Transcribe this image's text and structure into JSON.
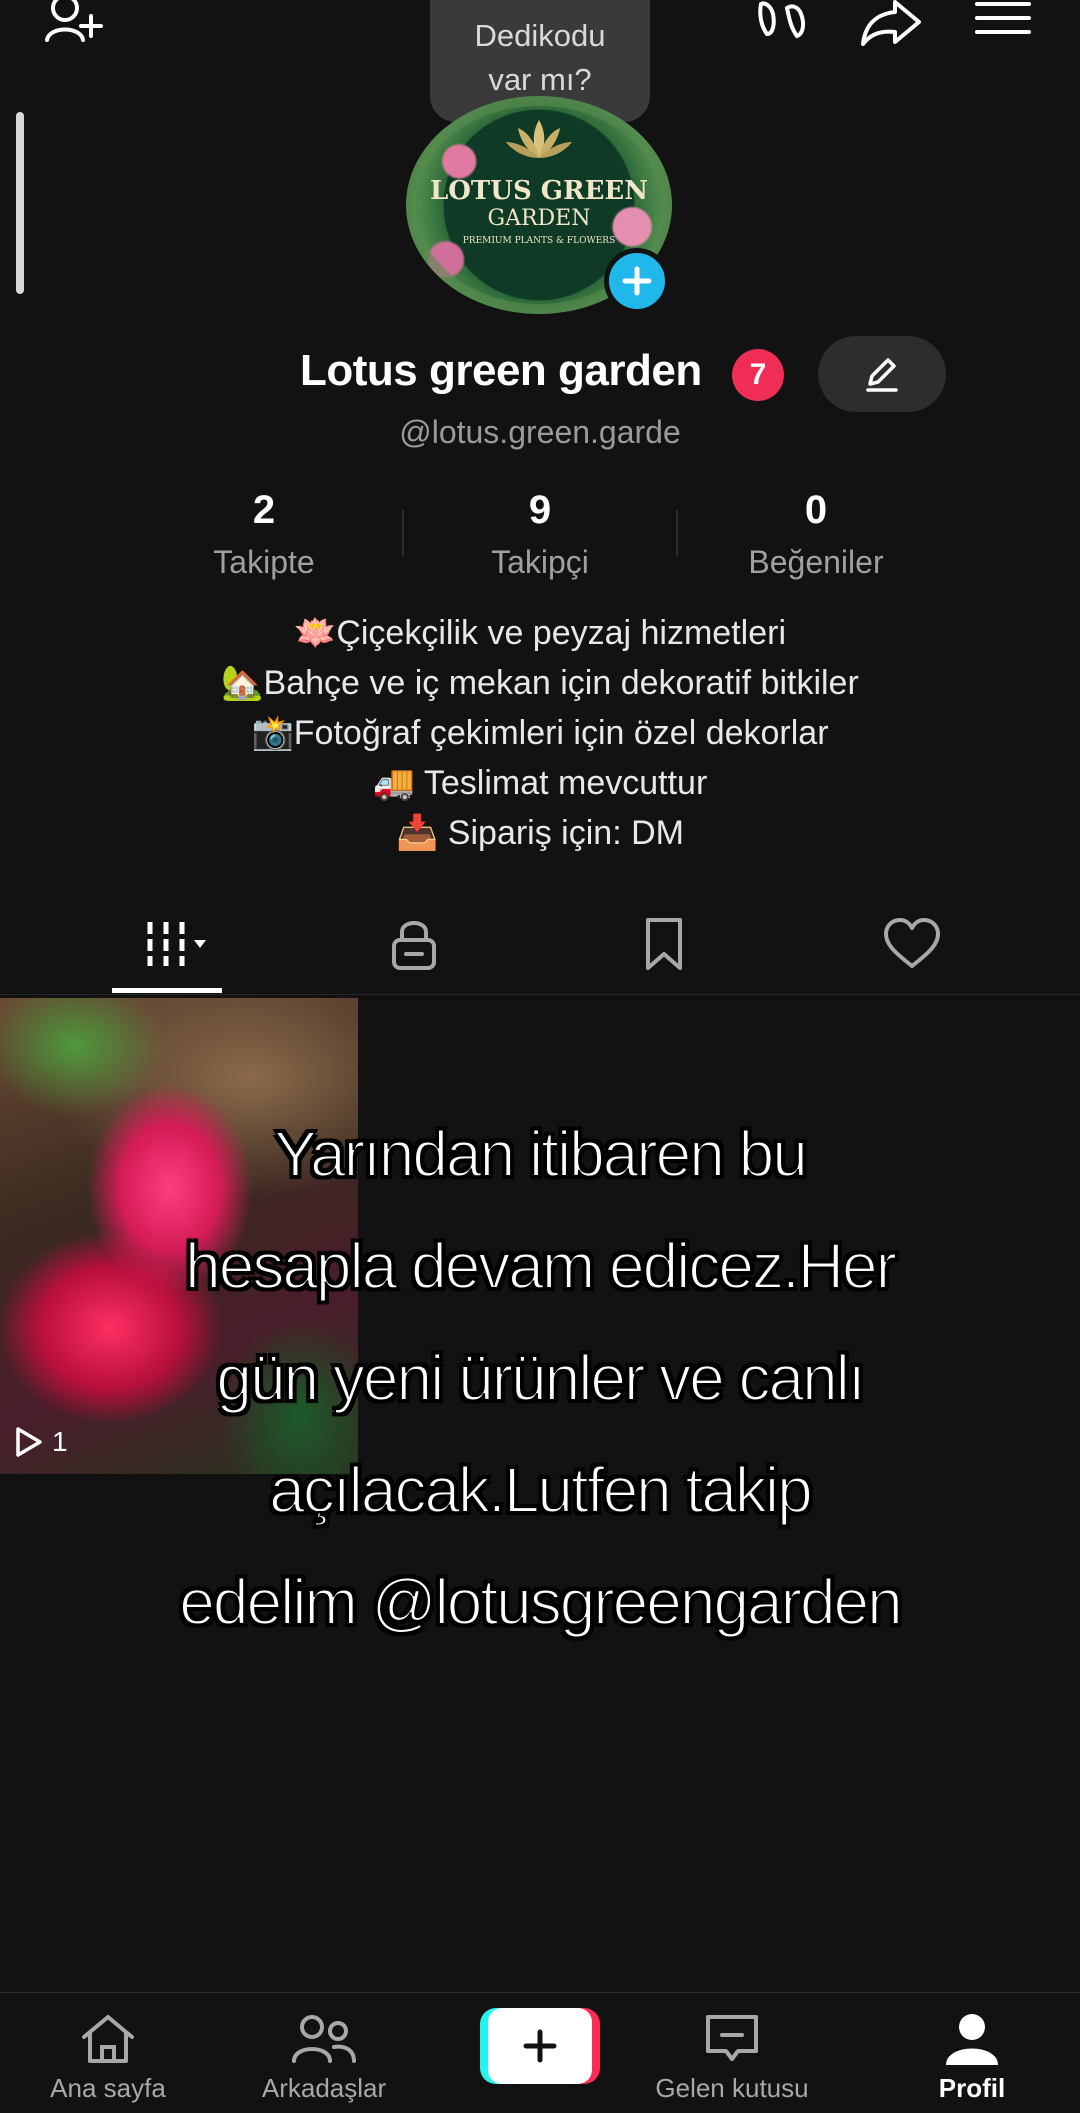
{
  "top_bar": {
    "icons": [
      "add-friend-icon",
      "footprints-icon",
      "share-icon",
      "menu-icon"
    ],
    "tooltip": "Dedikodu\nvar mı?"
  },
  "profile": {
    "avatar": {
      "logo_line1": "LOTUS GREEN",
      "logo_line2": "GARDEN",
      "logo_tagline": "PREMIUM PLANTS & FLOWERS"
    },
    "name": "Lotus green garden",
    "notification_count": "7",
    "handle": "@lotus.green.garde"
  },
  "stats": [
    {
      "value": "2",
      "label": "Takipte"
    },
    {
      "value": "9",
      "label": "Takipçi"
    },
    {
      "value": "0",
      "label": "Beğeniler"
    }
  ],
  "bio": [
    "🪷Çiçekçilik ve peyzaj hizmetleri",
    "🏡Bahçe ve iç mekan için dekoratif bitkiler",
    "📸Fotoğraf çekimleri için özel dekorlar",
    "🚚 Teslimat mevcuttur",
    "📥 Sipariş için: DM"
  ],
  "tabs": [
    "grid-icon",
    "lock-icon",
    "bookmark-icon",
    "heart-icon"
  ],
  "videos": [
    {
      "views": "1"
    }
  ],
  "overlay_text": [
    "Yarından itibaren bu",
    "hesapla devam edicez.Her",
    "gün yeni ürünler ve canlı",
    "açılacak.Lutfen takip",
    "edelim @lotusgreengarden"
  ],
  "bottom_nav": [
    {
      "label": "Ana sayfa",
      "icon": "home-icon"
    },
    {
      "label": "Arkadaşlar",
      "icon": "friends-icon"
    },
    {
      "label": "",
      "icon": "create-icon"
    },
    {
      "label": "Gelen kutusu",
      "icon": "inbox-icon"
    },
    {
      "label": "Profil",
      "icon": "profile-icon"
    }
  ],
  "colors": {
    "background": "#121212",
    "accent_blue": "#20b7ea",
    "badge_red": "#f02e55",
    "create_cyan": "#25f4ee",
    "create_pink": "#fe2c55"
  }
}
